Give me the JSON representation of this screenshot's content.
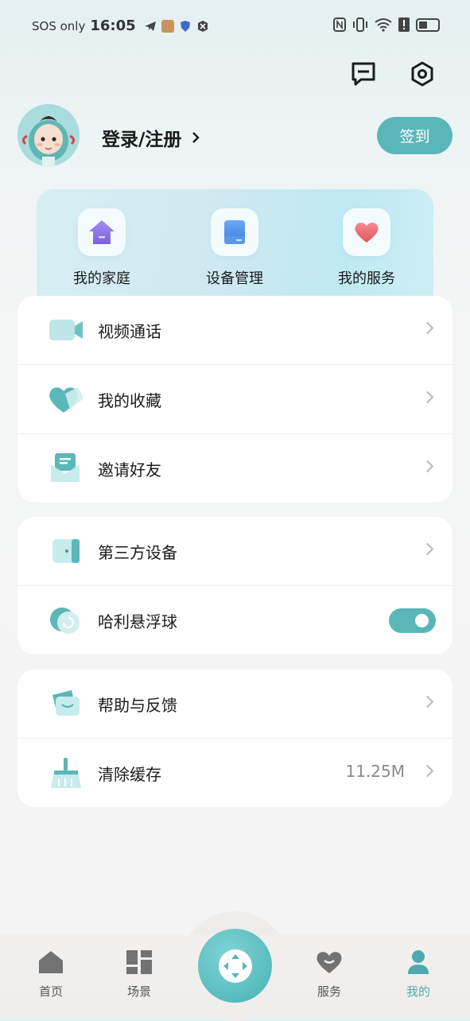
{
  "status_bar": {
    "carrier": "SOS only",
    "time": "16:05"
  },
  "profile": {
    "login_label": "登录/注册",
    "checkin_label": "签到"
  },
  "quick_actions": [
    {
      "label": "我的家庭",
      "icon": "home-icon"
    },
    {
      "label": "设备管理",
      "icon": "device-icon"
    },
    {
      "label": "我的服务",
      "icon": "heart-icon"
    }
  ],
  "menu": {
    "group1": [
      {
        "label": "视频通话",
        "icon": "video-call-icon"
      },
      {
        "label": "我的收藏",
        "icon": "favorites-icon"
      },
      {
        "label": "邀请好友",
        "icon": "invite-icon"
      }
    ],
    "group2": [
      {
        "label": "第三方设备",
        "icon": "third-party-device-icon"
      },
      {
        "label": "哈利悬浮球",
        "icon": "floating-ball-icon",
        "toggle": true
      }
    ],
    "group3": [
      {
        "label": "帮助与反馈",
        "icon": "help-feedback-icon"
      },
      {
        "label": "清除缓存",
        "icon": "broom-icon",
        "value": "11.25M"
      }
    ]
  },
  "bottom_nav": [
    {
      "label": "首页",
      "icon": "home-icon"
    },
    {
      "label": "场景",
      "icon": "scene-icon"
    },
    {
      "label": "服务",
      "icon": "heart-icon"
    },
    {
      "label": "我的",
      "icon": "profile-icon",
      "active": true
    }
  ],
  "colors": {
    "accent": "#5ab7b9",
    "background": "#f4f4f4"
  }
}
